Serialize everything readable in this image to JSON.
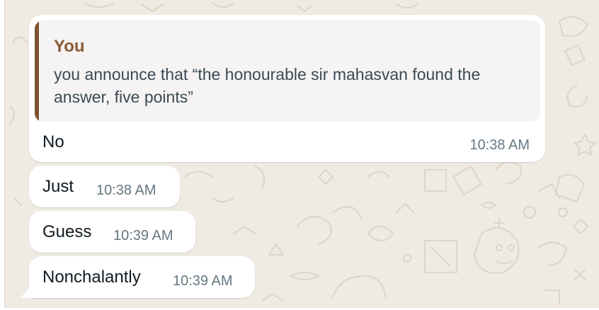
{
  "colors": {
    "wallpaper": "#efeae2",
    "bubble": "#ffffff",
    "quote_bar": "#7e5231",
    "quote_author": "#8a5a36",
    "timestamp": "#667781"
  },
  "messages": [
    {
      "reply_to": {
        "author": "You",
        "text": "you announce that “the honourable sir mahasvan found the answer, five points”"
      },
      "text": "No",
      "time": "10:38 AM"
    },
    {
      "text": "Just",
      "time": "10:38 AM"
    },
    {
      "text": "Guess",
      "time": "10:39 AM"
    },
    {
      "text": "Nonchalantly",
      "time": "10:39 AM"
    }
  ]
}
